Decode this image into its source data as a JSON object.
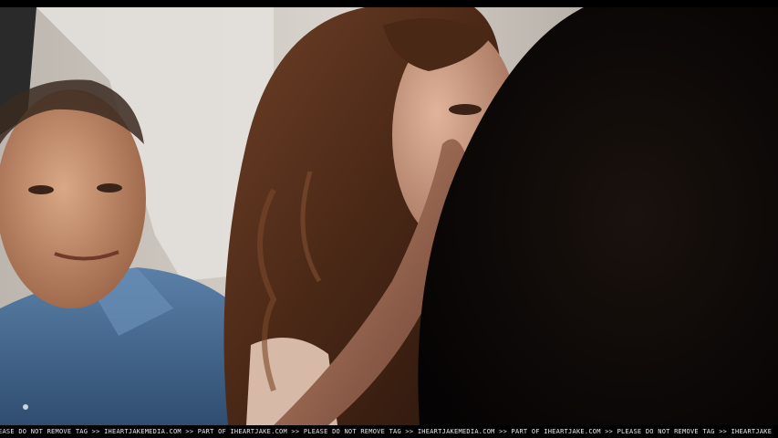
{
  "watermark": {
    "text": "EASE DO NOT REMOVE TAG >> IHEARTJAKEMEDIA.COM >> PART OF IHEARTJAKE.COM >> PLEASE DO NOT REMOVE TAG >> IHEARTJAKEMEDIA.COM >> PART OF IHEARTJAKE.COM >> PLEASE DO NOT REMOVE TAG >> IHEARTJAKE"
  },
  "colors": {
    "letterbox": "#000000",
    "background_wall": "#cfcac3",
    "shirt_blue": "#4a6f96",
    "skin_tone": "#c08a6c",
    "hair_brown": "#5a3420",
    "foreground_dark": "#0c0806"
  }
}
